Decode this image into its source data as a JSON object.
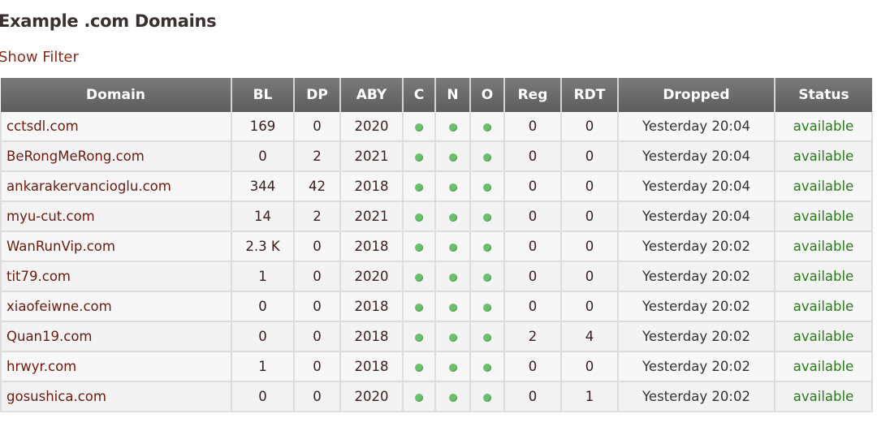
{
  "page": {
    "title": "Example .com Domains",
    "show_filter_label": "Show Filter"
  },
  "table": {
    "headers": [
      "Domain",
      "BL",
      "DP",
      "ABY",
      "C",
      "N",
      "O",
      "Reg",
      "RDT",
      "Dropped",
      "Status"
    ],
    "rows": [
      {
        "domain": "cctsdl.com",
        "bl": "169",
        "dp": "0",
        "aby": "2020",
        "c": "check-icon",
        "n": "check-icon",
        "o": "check-icon",
        "reg": "0",
        "rdt": "0",
        "dropped": "Yesterday 20:04",
        "status": "available"
      },
      {
        "domain": "BeRongMeRong.com",
        "bl": "0",
        "dp": "2",
        "aby": "2021",
        "c": "check-icon",
        "n": "check-icon",
        "o": "check-icon",
        "reg": "0",
        "rdt": "0",
        "dropped": "Yesterday 20:04",
        "status": "available"
      },
      {
        "domain": "ankarakervancioglu.com",
        "bl": "344",
        "dp": "42",
        "aby": "2018",
        "c": "check-icon",
        "n": "check-icon",
        "o": "check-icon",
        "reg": "0",
        "rdt": "0",
        "dropped": "Yesterday 20:04",
        "status": "available"
      },
      {
        "domain": "myu-cut.com",
        "bl": "14",
        "dp": "2",
        "aby": "2021",
        "c": "check-icon",
        "n": "check-icon",
        "o": "check-icon",
        "reg": "0",
        "rdt": "0",
        "dropped": "Yesterday 20:04",
        "status": "available"
      },
      {
        "domain": "WanRunVip.com",
        "bl": "2.3 K",
        "dp": "0",
        "aby": "2018",
        "c": "check-icon",
        "n": "check-icon",
        "o": "check-icon",
        "reg": "0",
        "rdt": "0",
        "dropped": "Yesterday 20:02",
        "status": "available"
      },
      {
        "domain": "tit79.com",
        "bl": "1",
        "dp": "0",
        "aby": "2020",
        "c": "check-icon",
        "n": "check-icon",
        "o": "check-icon",
        "reg": "0",
        "rdt": "0",
        "dropped": "Yesterday 20:02",
        "status": "available"
      },
      {
        "domain": "xiaofeiwne.com",
        "bl": "0",
        "dp": "0",
        "aby": "2018",
        "c": "check-icon",
        "n": "check-icon",
        "o": "check-icon",
        "reg": "0",
        "rdt": "0",
        "dropped": "Yesterday 20:02",
        "status": "available"
      },
      {
        "domain": "Quan19.com",
        "bl": "0",
        "dp": "0",
        "aby": "2018",
        "c": "check-icon",
        "n": "check-icon",
        "o": "check-icon",
        "reg": "2",
        "rdt": "4",
        "dropped": "Yesterday 20:02",
        "status": "available"
      },
      {
        "domain": "hrwyr.com",
        "bl": "1",
        "dp": "0",
        "aby": "2018",
        "c": "check-icon",
        "n": "check-icon",
        "o": "check-icon",
        "reg": "0",
        "rdt": "0",
        "dropped": "Yesterday 20:02",
        "status": "available"
      },
      {
        "domain": "gosushica.com",
        "bl": "0",
        "dp": "0",
        "aby": "2020",
        "c": "check-icon",
        "n": "check-icon",
        "o": "check-icon",
        "reg": "0",
        "rdt": "1",
        "dropped": "Yesterday 20:02",
        "status": "available"
      }
    ]
  },
  "colors": {
    "available": "#2a7a1a",
    "link": "#8a2a1e",
    "check": "#6cbf6c"
  }
}
